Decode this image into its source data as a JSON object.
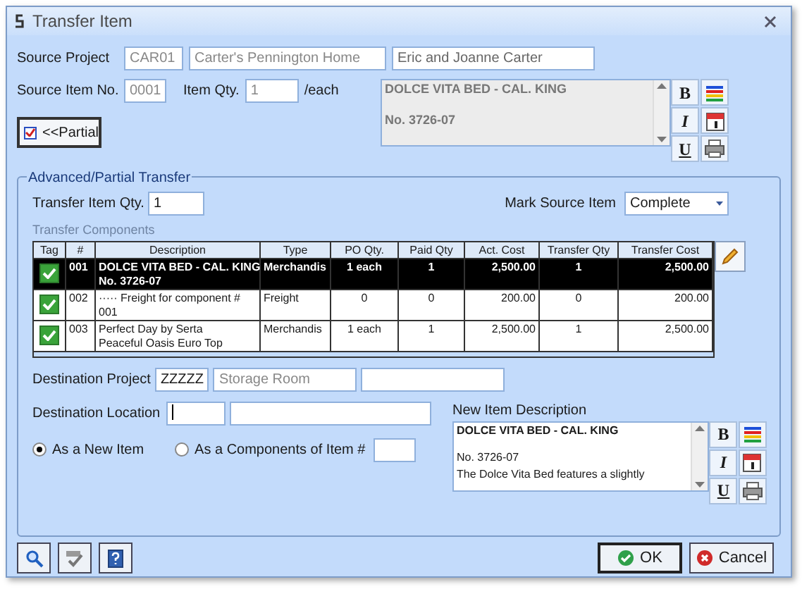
{
  "window": {
    "title": "Transfer Item"
  },
  "source": {
    "project_label": "Source Project",
    "project_code": "CAR01",
    "project_name": "Carter's Pennington Home",
    "client": "Eric and Joanne Carter",
    "item_no_label": "Source Item No.",
    "item_no": "0001",
    "qty_label": "Item Qty.",
    "qty": "1",
    "unit": "/each",
    "description_lines": [
      "DOLCE VITA BED - CAL. KING",
      "No. 3726-07"
    ],
    "format_buttons": [
      "B",
      "I",
      "U"
    ]
  },
  "partial_button": {
    "label": "<<Partial",
    "checked": true
  },
  "transfer": {
    "group_title": "Advanced/Partial Transfer",
    "qty_label": "Transfer Item Qty.",
    "qty": "1",
    "mark_label": "Mark Source Item",
    "mark_value": "Complete",
    "components_label": "Transfer Components",
    "columns": [
      "Tag",
      "#",
      "Description",
      "Type",
      "PO Qty.",
      "Paid Qty",
      "Act. Cost",
      "Transfer Qty",
      "Transfer Cost"
    ],
    "rows": [
      {
        "tag": true,
        "selected": true,
        "number": "001",
        "description": "DOLCE VITA BED - CAL. KING\nNo. 3726-07",
        "type": "Merchandis",
        "po_qty": "1 each",
        "paid_qty": "1",
        "act_cost": "2,500.00",
        "transfer_qty": "1",
        "transfer_cost": "2,500.00"
      },
      {
        "tag": true,
        "selected": false,
        "number": "002",
        "description": "····· Freight for component #\n001",
        "type": "Freight",
        "po_qty": "0",
        "paid_qty": "0",
        "act_cost": "200.00",
        "transfer_qty": "0",
        "transfer_cost": "200.00"
      },
      {
        "tag": true,
        "selected": false,
        "number": "003",
        "description": "Perfect Day by Serta\nPeaceful Oasis Euro Top",
        "type": "Merchandis",
        "po_qty": "1 each",
        "paid_qty": "1",
        "act_cost": "2,500.00",
        "transfer_qty": "1",
        "transfer_cost": "2,500.00"
      }
    ]
  },
  "destination": {
    "project_label": "Destination Project",
    "project_code": "ZZZZZ",
    "project_name": "Storage Room",
    "location_label": "Destination Location",
    "radios": [
      {
        "label": "As a New Item",
        "selected": true
      },
      {
        "label": "As a Components of Item #",
        "selected": false
      }
    ]
  },
  "new_item": {
    "label": "New Item Description",
    "lines": [
      "DOLCE VITA BED - CAL. KING",
      "No. 3726-07",
      "The Dolce Vita Bed features a slightly"
    ],
    "format_buttons": [
      "B",
      "I",
      "U"
    ]
  },
  "buttons": [
    {
      "label": "OK",
      "kind": "ok"
    },
    {
      "label": "Cancel",
      "kind": "cancel"
    }
  ]
}
